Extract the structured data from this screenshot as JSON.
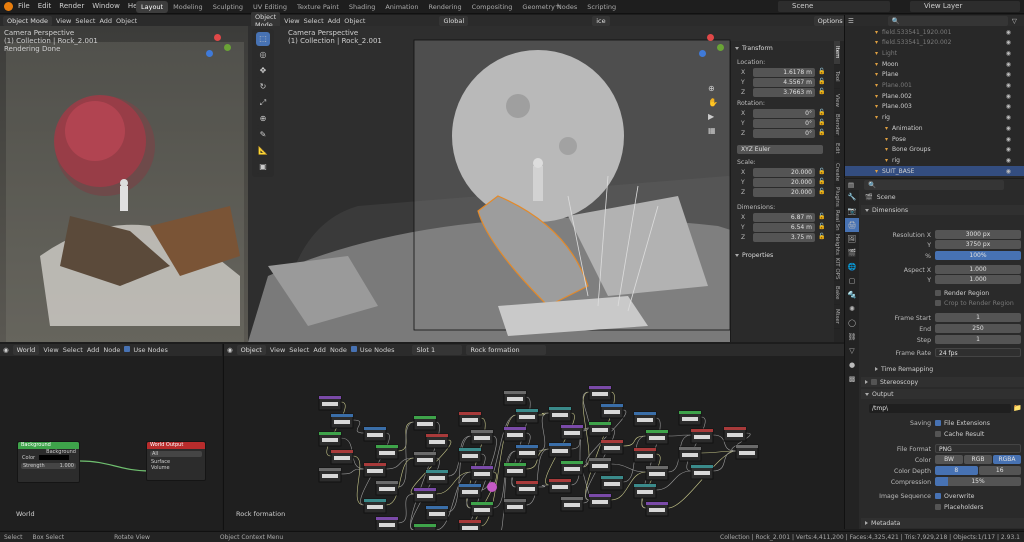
{
  "menu": [
    "File",
    "Edit",
    "Render",
    "Window",
    "Help"
  ],
  "workspaces": [
    "Layout",
    "Modeling",
    "Sculpting",
    "UV Editing",
    "Texture Paint",
    "Shading",
    "Animation",
    "Rendering",
    "Compositing",
    "Geometry Nodes",
    "Scripting"
  ],
  "scene": "Scene",
  "view_layer": "View Layer",
  "left_vp": {
    "mode": "Object Mode",
    "menus": [
      "View",
      "Select",
      "Add",
      "Object"
    ],
    "orient": "Global",
    "search": "ice",
    "cam": "Camera Perspective",
    "coll": "(1) Collection | Rock_2.001",
    "status": "Rendering Done"
  },
  "main_vp": {
    "mode": "Object Mode",
    "menus": [
      "View",
      "Select",
      "Add",
      "Object"
    ],
    "orient": "Global",
    "search": "ice",
    "options": "Options",
    "cam": "Camera Perspective",
    "coll": "(1) Collection | Rock_2.001"
  },
  "npanel": {
    "transform": "Transform",
    "location": "Location:",
    "loc": [
      {
        "a": "X",
        "v": "1.6178 m"
      },
      {
        "a": "Y",
        "v": "4.5567 m"
      },
      {
        "a": "Z",
        "v": "3.7663 m"
      }
    ],
    "rotation": "Rotation:",
    "rot": [
      {
        "a": "X",
        "v": "0°"
      },
      {
        "a": "Y",
        "v": "0°"
      },
      {
        "a": "Z",
        "v": "0°"
      }
    ],
    "euler": "XYZ Euler",
    "scale": "Scale:",
    "scl": [
      {
        "a": "X",
        "v": "20.000"
      },
      {
        "a": "Y",
        "v": "20.000"
      },
      {
        "a": "Z",
        "v": "20.000"
      }
    ],
    "dimensions": "Dimensions:",
    "dim": [
      {
        "a": "X",
        "v": "6.87 m"
      },
      {
        "a": "Y",
        "v": "6.54 m"
      },
      {
        "a": "Z",
        "v": "3.75 m"
      }
    ],
    "properties": "Properties",
    "tabs": [
      "Item",
      "Tool",
      "View",
      "Blender",
      "Edit",
      "Create",
      "Plugins",
      "Real Sn",
      "Heights",
      "KIT OPS",
      "Bake",
      "Mixer"
    ]
  },
  "outliner": {
    "items": [
      {
        "name": "field.533541_1920.001",
        "ind": 1,
        "dim": true
      },
      {
        "name": "field.533541_1920.002",
        "ind": 1,
        "dim": true
      },
      {
        "name": "Light",
        "ind": 1,
        "dim": true
      },
      {
        "name": "Moon",
        "ind": 1,
        "dim": false
      },
      {
        "name": "Plane",
        "ind": 1,
        "dim": false
      },
      {
        "name": "Plane.001",
        "ind": 1,
        "dim": true
      },
      {
        "name": "Plane.002",
        "ind": 1,
        "dim": false
      },
      {
        "name": "Plane.003",
        "ind": 1,
        "dim": false
      },
      {
        "name": "rig",
        "ind": 1,
        "dim": false
      },
      {
        "name": "Animation",
        "ind": 2,
        "dim": false
      },
      {
        "name": "Pose",
        "ind": 2,
        "dim": false
      },
      {
        "name": "Bone Groups",
        "ind": 2,
        "dim": false
      },
      {
        "name": "rig",
        "ind": 2,
        "dim": false
      },
      {
        "name": "SUIT_BASE",
        "ind": 1,
        "dim": false
      }
    ]
  },
  "props": {
    "scene": "Scene",
    "dimensions": "Dimensions",
    "res_x_label": "Resolution X",
    "res_x": "3000 px",
    "res_y_label": "Y",
    "res_y": "3750 px",
    "pct_label": "%",
    "pct": "100%",
    "asp_x_label": "Aspect X",
    "asp_x": "1.000",
    "asp_y_label": "Y",
    "asp_y": "1.000",
    "render_region": "Render Region",
    "crop": "Crop to Render Region",
    "fs_label": "Frame Start",
    "fs": "1",
    "end_label": "End",
    "end": "250",
    "step_label": "Step",
    "step": "1",
    "fr_label": "Frame Rate",
    "fr": "24 fps",
    "time_remap": "Time Remapping",
    "stereo": "Stereoscopy",
    "output": "Output",
    "path": "/tmp\\",
    "saving": "Saving",
    "file_ext": "File Extensions",
    "cache": "Cache Result",
    "ff_label": "File Format",
    "ff": "PNG",
    "color_label": "Color",
    "bw": "BW",
    "rgb": "RGB",
    "rgba": "RGBA",
    "depth_label": "Color Depth",
    "d8": "8",
    "d16": "16",
    "comp_label": "Compression",
    "comp": "15%",
    "seq_label": "Image Sequence",
    "overwrite": "Overwrite",
    "placeholders": "Placeholders",
    "metadata": "Metadata"
  },
  "world_editor": {
    "type": "World",
    "menus": [
      "View",
      "Select",
      "Add",
      "Node"
    ],
    "use_nodes": "Use Nodes",
    "name": "World",
    "bg": {
      "title": "Background",
      "out": "Background",
      "color": "Color",
      "strength": "Strength",
      "sval": "1.000"
    },
    "wo": {
      "title": "World Output",
      "target": "All",
      "surface": "Surface",
      "volume": "Volume"
    }
  },
  "node_editor": {
    "type": "Object",
    "menus": [
      "View",
      "Select",
      "Add",
      "Node"
    ],
    "use_nodes": "Use Nodes",
    "slot": "Slot 1",
    "material": "Rock formation",
    "name": "Rock formation"
  },
  "status": {
    "select": "Select",
    "box": "Box Select",
    "rotate": "Rotate View",
    "context": "Object Context Menu",
    "info": "Collection | Rock_2.001 | Verts:4,411,200 | Faces:4,325,421 | Tris:7,929,218 | Objects:1/117 | 2.93.1"
  }
}
